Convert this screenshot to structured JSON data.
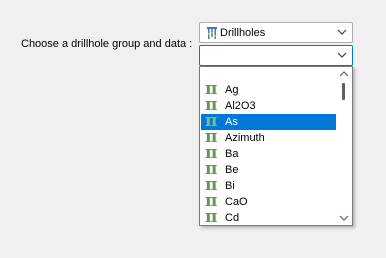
{
  "form": {
    "label": "Choose a drillhole group and data :"
  },
  "group_combo": {
    "value": "Drillholes",
    "icon": "drillholes-icon"
  },
  "data_combo": {
    "value": ""
  },
  "dropdown": {
    "items": [
      {
        "label": "Ag",
        "selected": false
      },
      {
        "label": "Al2O3",
        "selected": false
      },
      {
        "label": "As",
        "selected": true
      },
      {
        "label": "Azimuth",
        "selected": false
      },
      {
        "label": "Ba",
        "selected": false
      },
      {
        "label": "Be",
        "selected": false
      },
      {
        "label": "Bi",
        "selected": false
      },
      {
        "label": "CaO",
        "selected": false
      },
      {
        "label": "Cd",
        "selected": false
      }
    ],
    "item_icon_glyph": "π",
    "item_icon": "pi-icon"
  },
  "colors": {
    "selection": "#0078d7",
    "pi_icon": "#5a9e4b",
    "focus_border": "#0078d7"
  }
}
